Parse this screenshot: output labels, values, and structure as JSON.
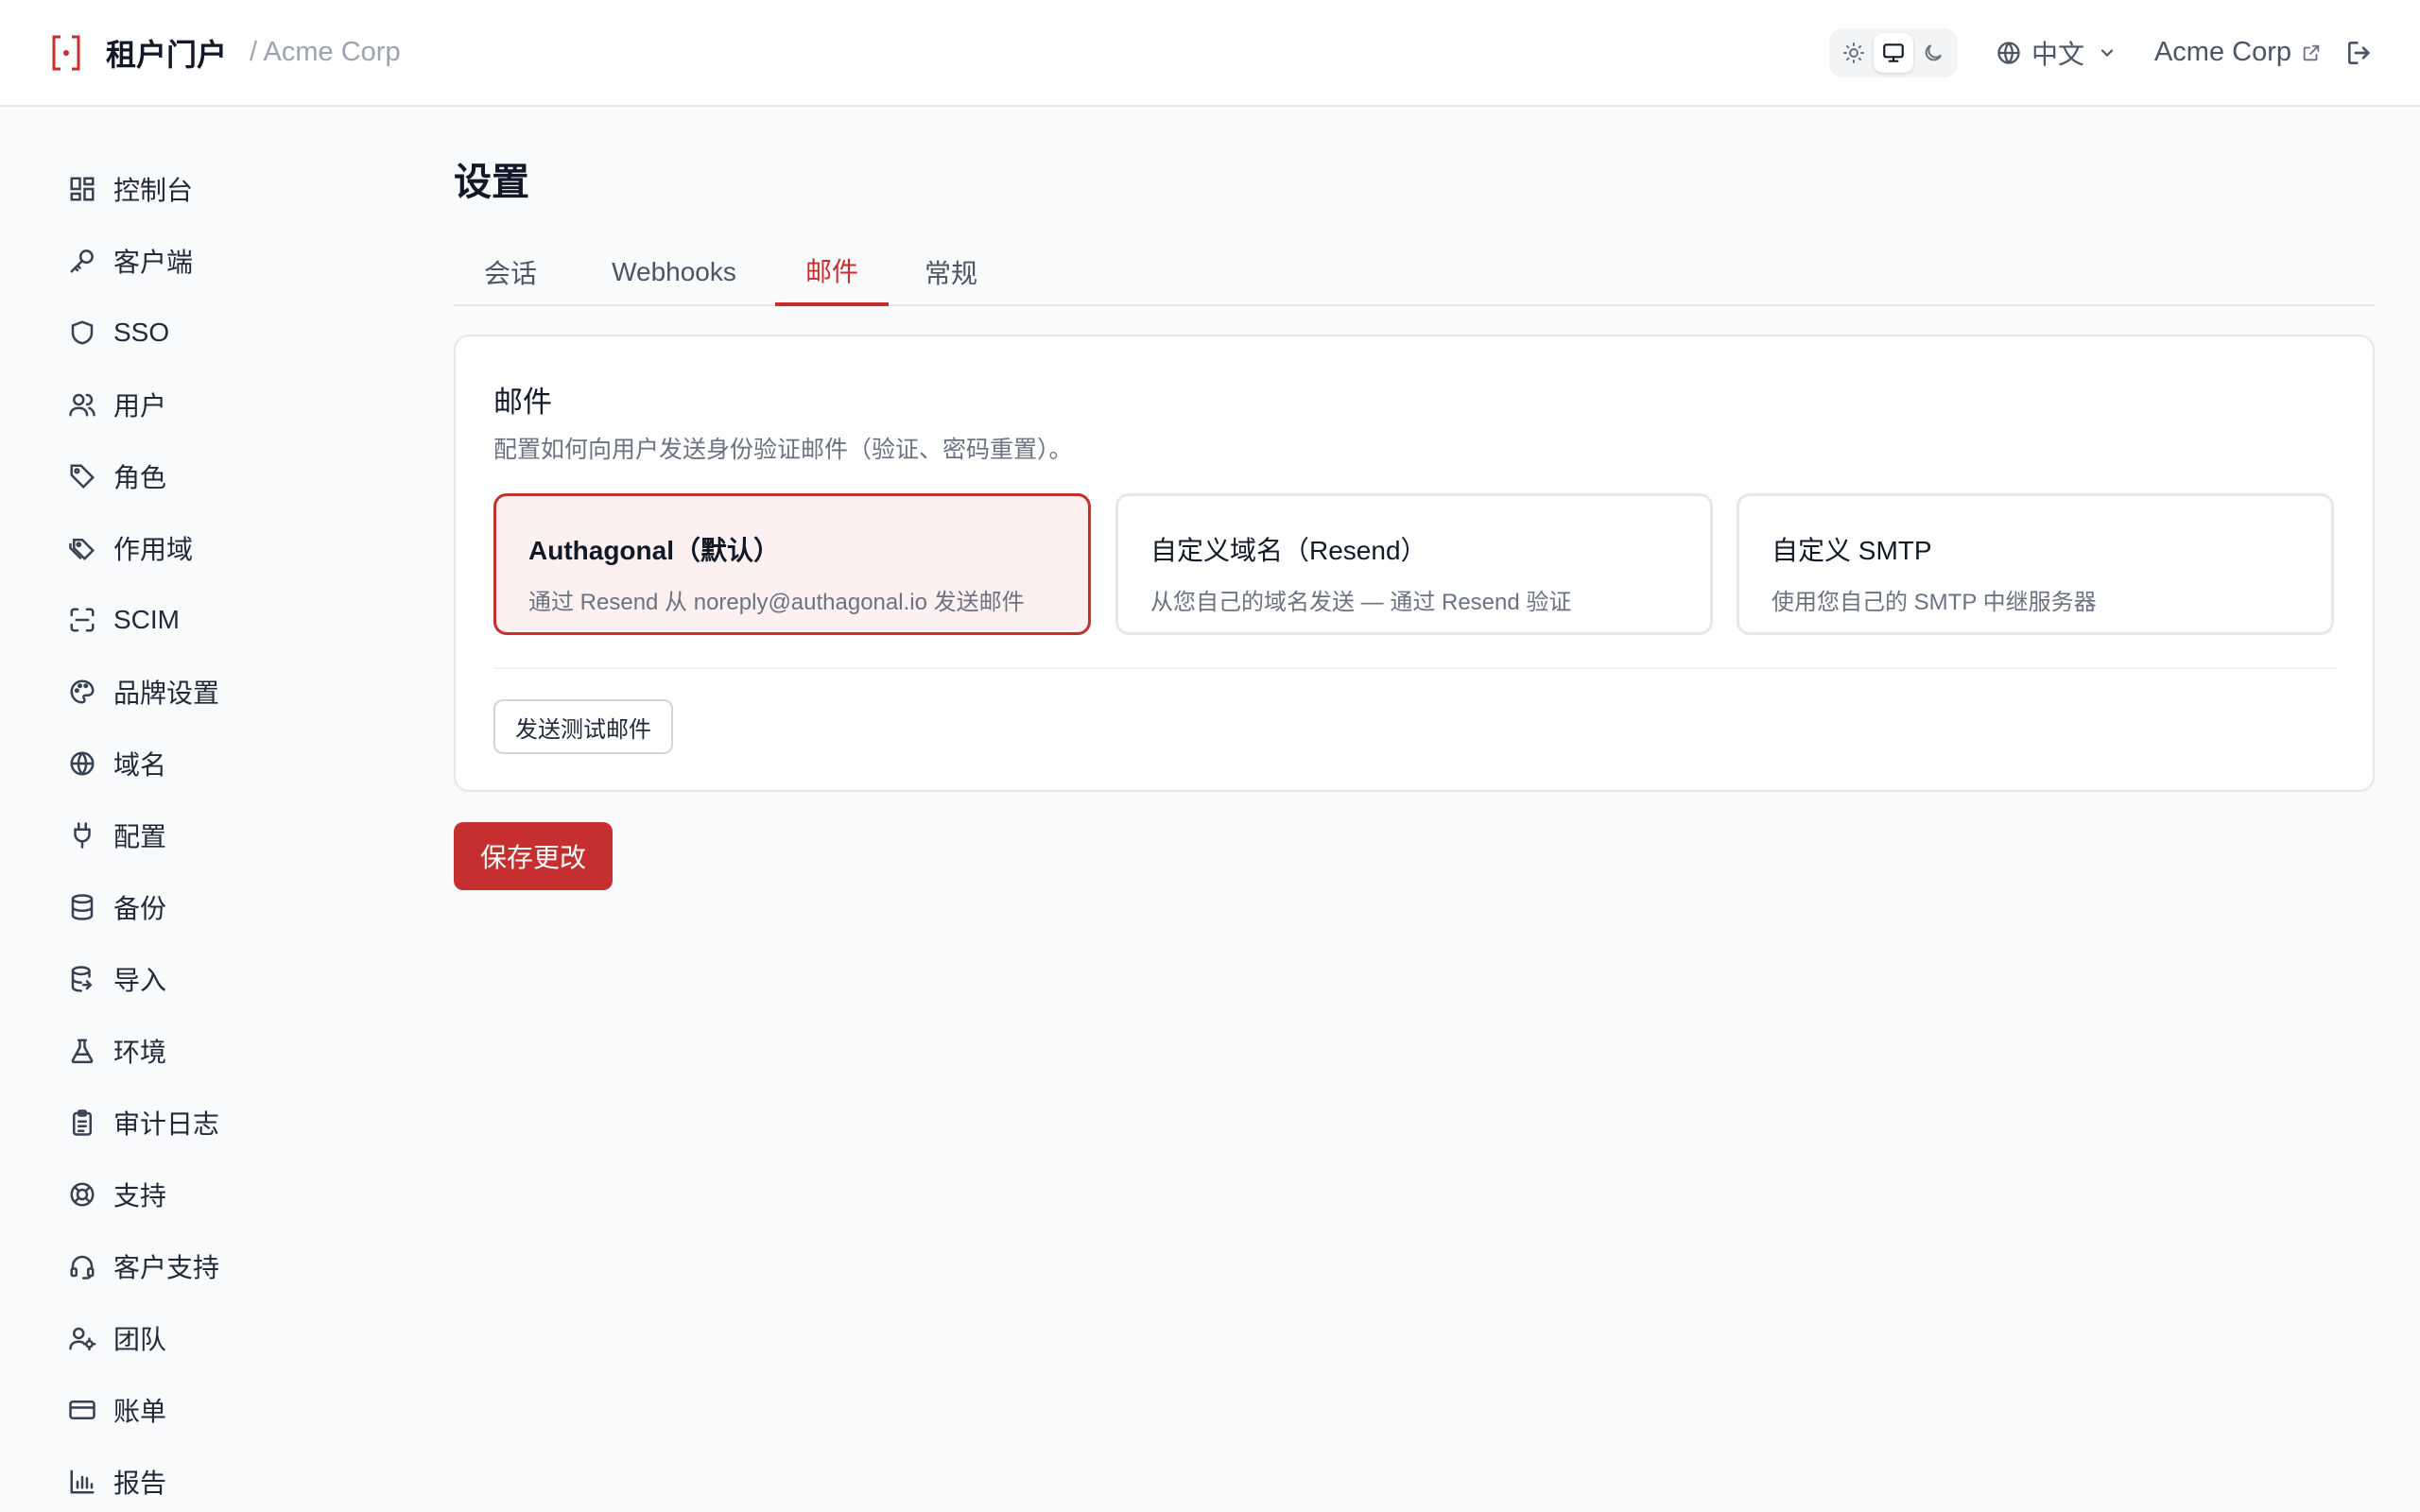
{
  "header": {
    "app_title": "租户门户",
    "org_breadcrumb": "/ Acme Corp",
    "language": "中文",
    "org_link": "Acme Corp",
    "theme_active": "system"
  },
  "sidebar": {
    "items": [
      {
        "label": "控制台",
        "icon": "dashboard-icon"
      },
      {
        "label": "客户端",
        "icon": "key-icon"
      },
      {
        "label": "SSO",
        "icon": "shield-icon"
      },
      {
        "label": "用户",
        "icon": "users-icon"
      },
      {
        "label": "角色",
        "icon": "tag-icon"
      },
      {
        "label": "作用域",
        "icon": "tags-icon"
      },
      {
        "label": "SCIM",
        "icon": "scan-icon"
      },
      {
        "label": "品牌设置",
        "icon": "palette-icon"
      },
      {
        "label": "域名",
        "icon": "globe-icon"
      },
      {
        "label": "配置",
        "icon": "plug-icon"
      },
      {
        "label": "备份",
        "icon": "database-icon"
      },
      {
        "label": "导入",
        "icon": "database-import-icon"
      },
      {
        "label": "环境",
        "icon": "flask-icon"
      },
      {
        "label": "审计日志",
        "icon": "clipboard-icon"
      },
      {
        "label": "支持",
        "icon": "lifebuoy-icon"
      },
      {
        "label": "客户支持",
        "icon": "headset-icon"
      },
      {
        "label": "团队",
        "icon": "user-cog-icon"
      },
      {
        "label": "账单",
        "icon": "credit-card-icon"
      },
      {
        "label": "报告",
        "icon": "bar-chart-icon"
      }
    ]
  },
  "main": {
    "title": "设置",
    "tabs": [
      {
        "label": "会话"
      },
      {
        "label": "Webhooks"
      },
      {
        "label": "邮件",
        "active": true
      },
      {
        "label": "常规"
      }
    ],
    "email_card": {
      "title": "邮件",
      "description": "配置如何向用户发送身份验证邮件（验证、密码重置）。",
      "options": [
        {
          "title": "Authagonal（默认）",
          "description": "通过 Resend 从 noreply@authagonal.io 发送邮件",
          "selected": true
        },
        {
          "title": "自定义域名（Resend）",
          "description": "从您自己的域名发送 — 通过 Resend 验证",
          "selected": false
        },
        {
          "title": "自定义 SMTP",
          "description": "使用您自己的 SMTP 中继服务器",
          "selected": false
        }
      ],
      "test_button": "发送测试邮件"
    },
    "save_button": "保存更改"
  },
  "colors": {
    "accent": "#c62f2f",
    "selected_bg": "#fdf0f0",
    "text": "#111827",
    "muted": "#6b7280"
  }
}
